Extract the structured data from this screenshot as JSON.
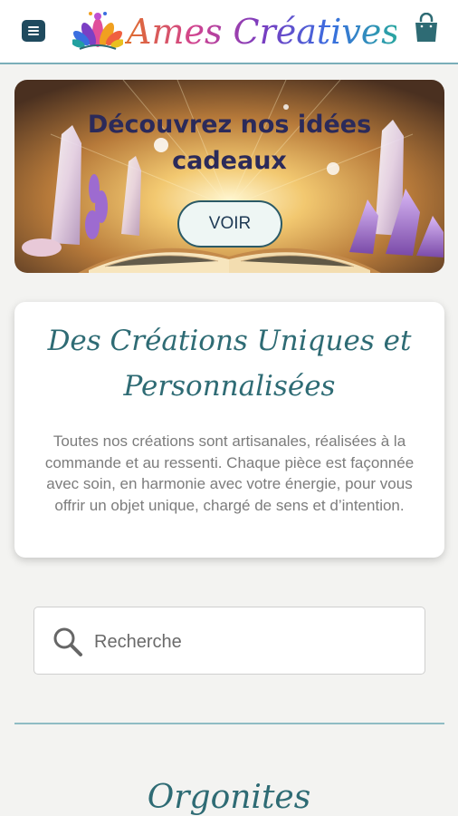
{
  "header": {
    "brand": "Ames Créatives",
    "menu_icon": "hamburger-menu-icon",
    "cart_icon": "shopping-bag-icon",
    "logo_icon": "lotus-logo-icon",
    "colors": {
      "menu_bg": "#1f4a5e",
      "border": "#7aaeb8",
      "cart": "#2e6b74"
    }
  },
  "banner": {
    "title": "Découvrez nos idées cadeaux",
    "button_label": "VOIR",
    "colors": {
      "title": "#2b2a5a",
      "button_bg": "#eef6f4",
      "button_border": "#2b5a66"
    }
  },
  "intro": {
    "title": "Des Créations Uniques et Personnalisées",
    "text": "Toutes nos créations sont artisanales, réalisées à la commande et au ressenti. Chaque pièce est façonnée avec soin, en harmonie avec votre énergie, pour vous offrir un objet unique, chargé de sens et d’intention.",
    "colors": {
      "title": "#2e6b74",
      "text": "#7c7c7c"
    }
  },
  "search": {
    "placeholder": "Recherche",
    "value": "",
    "icon": "search-icon"
  },
  "section": {
    "title": "Orgonites"
  }
}
